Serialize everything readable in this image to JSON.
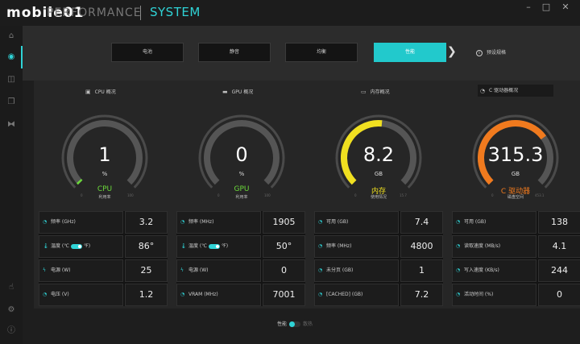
{
  "app": {
    "logo": "mobile01",
    "name": "PERFORMANCE",
    "section": "SYSTEM",
    "minimize": "–",
    "maximize": "□",
    "close": "✕"
  },
  "colors": {
    "accent": "#2fd3d6",
    "gpu": "#6bd83a",
    "memory": "#f0e020",
    "drive": "#f07a1e"
  },
  "modes": {
    "items": [
      {
        "label": "电池"
      },
      {
        "label": "静音"
      },
      {
        "label": "均衡"
      },
      {
        "label": "性能"
      }
    ],
    "active_index": 3,
    "preset_label": "预设规格"
  },
  "panels": [
    {
      "header": "CPU 概况",
      "gauge": {
        "value": "1",
        "unit": "%",
        "name": "CPU",
        "sub": "利用率",
        "min": "0",
        "max": "100",
        "fraction": 0.01
      },
      "stats": [
        {
          "label": "频率 (GHz)",
          "value": "3.2"
        },
        {
          "label_a": "温度 (℃",
          "label_b": "℉)",
          "value": "86°"
        },
        {
          "label": "电源 (W)",
          "value": "25"
        },
        {
          "label": "电压 (V)",
          "value": "1.2"
        }
      ]
    },
    {
      "header": "GPU 概况",
      "gauge": {
        "value": "0",
        "unit": "%",
        "name": "GPU",
        "sub": "利用率",
        "min": "0",
        "max": "100",
        "fraction": 0.0
      },
      "stats": [
        {
          "label": "频率 (MHz)",
          "value": "1905"
        },
        {
          "label_a": "温度 (℃",
          "label_b": "℉)",
          "value": "50°"
        },
        {
          "label": "电源 (W)",
          "value": "0"
        },
        {
          "label": "VRAM (MHz)",
          "value": "7001"
        }
      ]
    },
    {
      "header": "内存概况",
      "gauge": {
        "value": "8.2",
        "unit": "GB",
        "name": "内存",
        "sub": "使用情况",
        "min": "0",
        "max": "15.7",
        "fraction": 0.52
      },
      "stats": [
        {
          "label": "可用 (GB)",
          "value": "7.4"
        },
        {
          "label": "频率 (MHz)",
          "value": "4800"
        },
        {
          "label": "未分页 (GB)",
          "value": "1"
        },
        {
          "label": "[CACHED] (GB)",
          "value": "7.2"
        }
      ]
    },
    {
      "header": "C 驱动器概况",
      "gauge": {
        "value": "315.3",
        "unit": "GB",
        "name": "C 驱动器",
        "sub": "磁盘空间",
        "min": "0",
        "max": "453.1",
        "fraction": 0.7
      },
      "stats": [
        {
          "label": "可用 (GB)",
          "value": "138"
        },
        {
          "label": "读取速度 (MB/s)",
          "value": "4.1"
        },
        {
          "label": "写入速度 (KB/s)",
          "value": "244"
        },
        {
          "label": "活动时间 (%)",
          "value": "0"
        }
      ]
    }
  ],
  "footer": {
    "on_label": "性能",
    "off_label": "散热"
  }
}
